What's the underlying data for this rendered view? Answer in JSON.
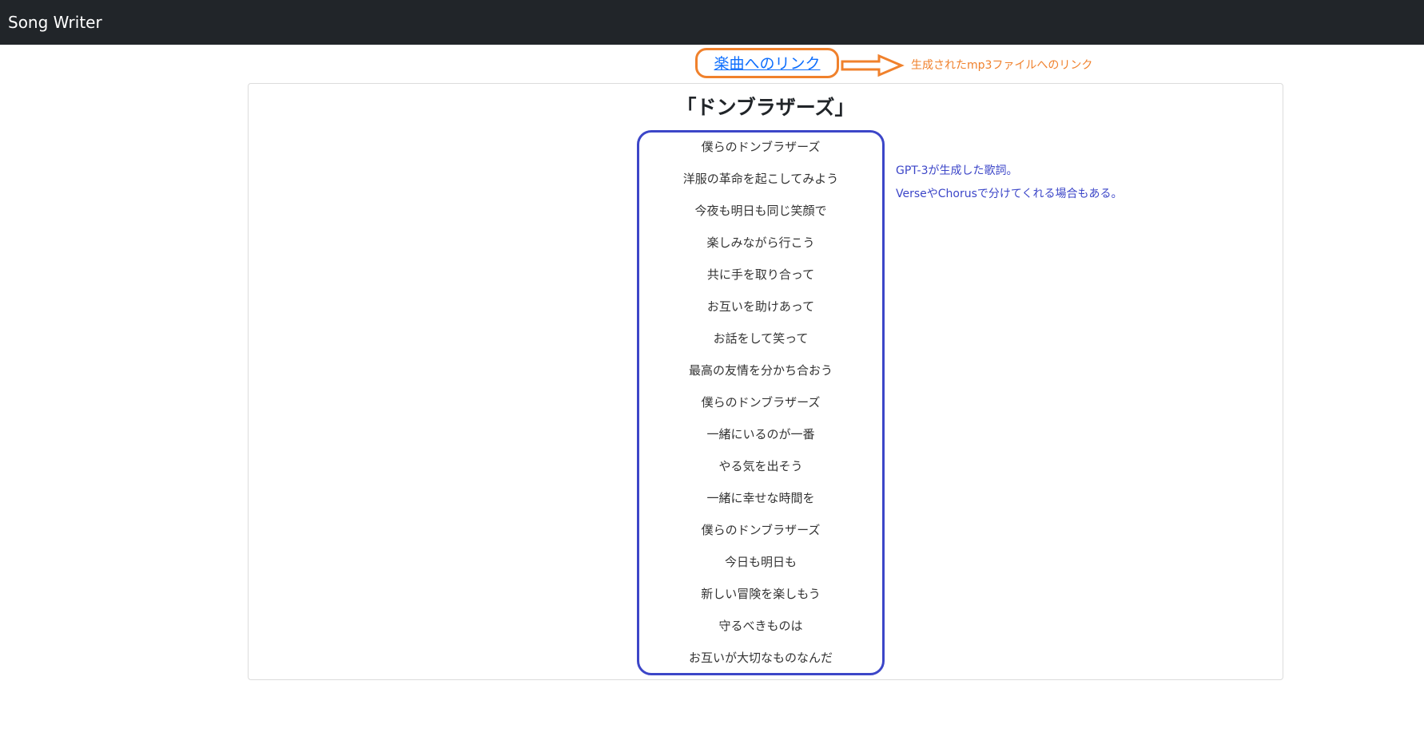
{
  "navbar": {
    "brand": "Song Writer"
  },
  "song_link": {
    "label": "楽曲へのリンク"
  },
  "annotations": {
    "link_note": "生成されたmp3ファイルへのリンク",
    "lyrics_note_line1": "GPT-3が生成した歌詞。",
    "lyrics_note_line2": "VerseやChorusで分けてくれる場合もある。",
    "link_color": "#f0812c",
    "lyrics_color": "#3c46c8"
  },
  "song": {
    "title": "「ドンブラザーズ」",
    "lyrics": [
      "僕らのドンブラザーズ",
      "洋服の革命を起こしてみよう",
      "今夜も明日も同じ笑顔で",
      "楽しみながら行こう",
      "共に手を取り合って",
      "お互いを助けあって",
      "お話をして笑って",
      "最高の友情を分かち合おう",
      "僕らのドンブラザーズ",
      "一緒にいるのが一番",
      "やる気を出そう",
      "一緒に幸せな時間を",
      "僕らのドンブラザーズ",
      "今日も明日も",
      "新しい冒険を楽しもう",
      "守るべきものは",
      "お互いが大切なものなんだ"
    ]
  }
}
